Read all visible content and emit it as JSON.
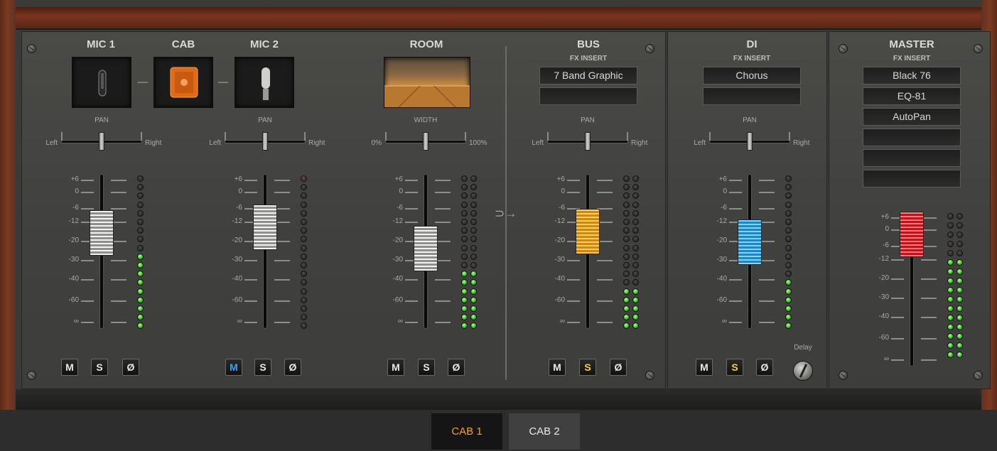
{
  "tabs": [
    {
      "label": "CAB 1",
      "active": true
    },
    {
      "label": "CAB 2",
      "active": false
    }
  ],
  "strips": {
    "mic1": {
      "title": "MIC 1",
      "pan_label": "PAN",
      "left": "Left",
      "right": "Right",
      "pan": 0.5
    },
    "cab": {
      "title": "CAB"
    },
    "mic2": {
      "title": "MIC 2",
      "pan_label": "PAN",
      "left": "Left",
      "right": "Right",
      "pan": 0.5
    },
    "room": {
      "title": "ROOM",
      "width_label": "WIDTH",
      "min": "0%",
      "max": "100%",
      "width": 0.5
    },
    "bus": {
      "title": "BUS",
      "fx_header": "FX INSERT",
      "fx": [
        "7 Band Graphic",
        ""
      ],
      "pan_label": "PAN",
      "left": "Left",
      "right": "Right",
      "pan": 0.5
    },
    "di": {
      "title": "DI",
      "fx_header": "FX INSERT",
      "fx": [
        "Chorus",
        ""
      ],
      "pan_label": "PAN",
      "left": "Left",
      "right": "Right",
      "pan": 0.5,
      "delay_label": "Delay"
    },
    "master": {
      "title": "MASTER",
      "fx_header": "FX INSERT",
      "fx": [
        "Black 76",
        "EQ-81",
        "AutoPan",
        "",
        "",
        ""
      ]
    }
  },
  "scale": [
    "+6",
    "0",
    "-6",
    "-12",
    "-20",
    "-30",
    "-40",
    "-60",
    "∞"
  ],
  "buttons": {
    "m": "M",
    "s": "S",
    "phase": "Ø"
  },
  "states": {
    "mic1": {
      "mute": false,
      "solo": false
    },
    "mic2": {
      "mute": true,
      "solo": false
    },
    "room": {
      "mute": false,
      "solo": false
    },
    "bus": {
      "mute": false,
      "solo": true
    },
    "di": {
      "mute": false,
      "solo": true
    }
  },
  "colors": {
    "bus_fader": "#e3961a",
    "di_fader": "#2a9ae0",
    "master_fader": "#d21a24",
    "tab_active_text": "#f0a020",
    "mute_on": "#35a3ff",
    "solo_on": "#ffd21f",
    "led_on": "#2fbf1a"
  }
}
